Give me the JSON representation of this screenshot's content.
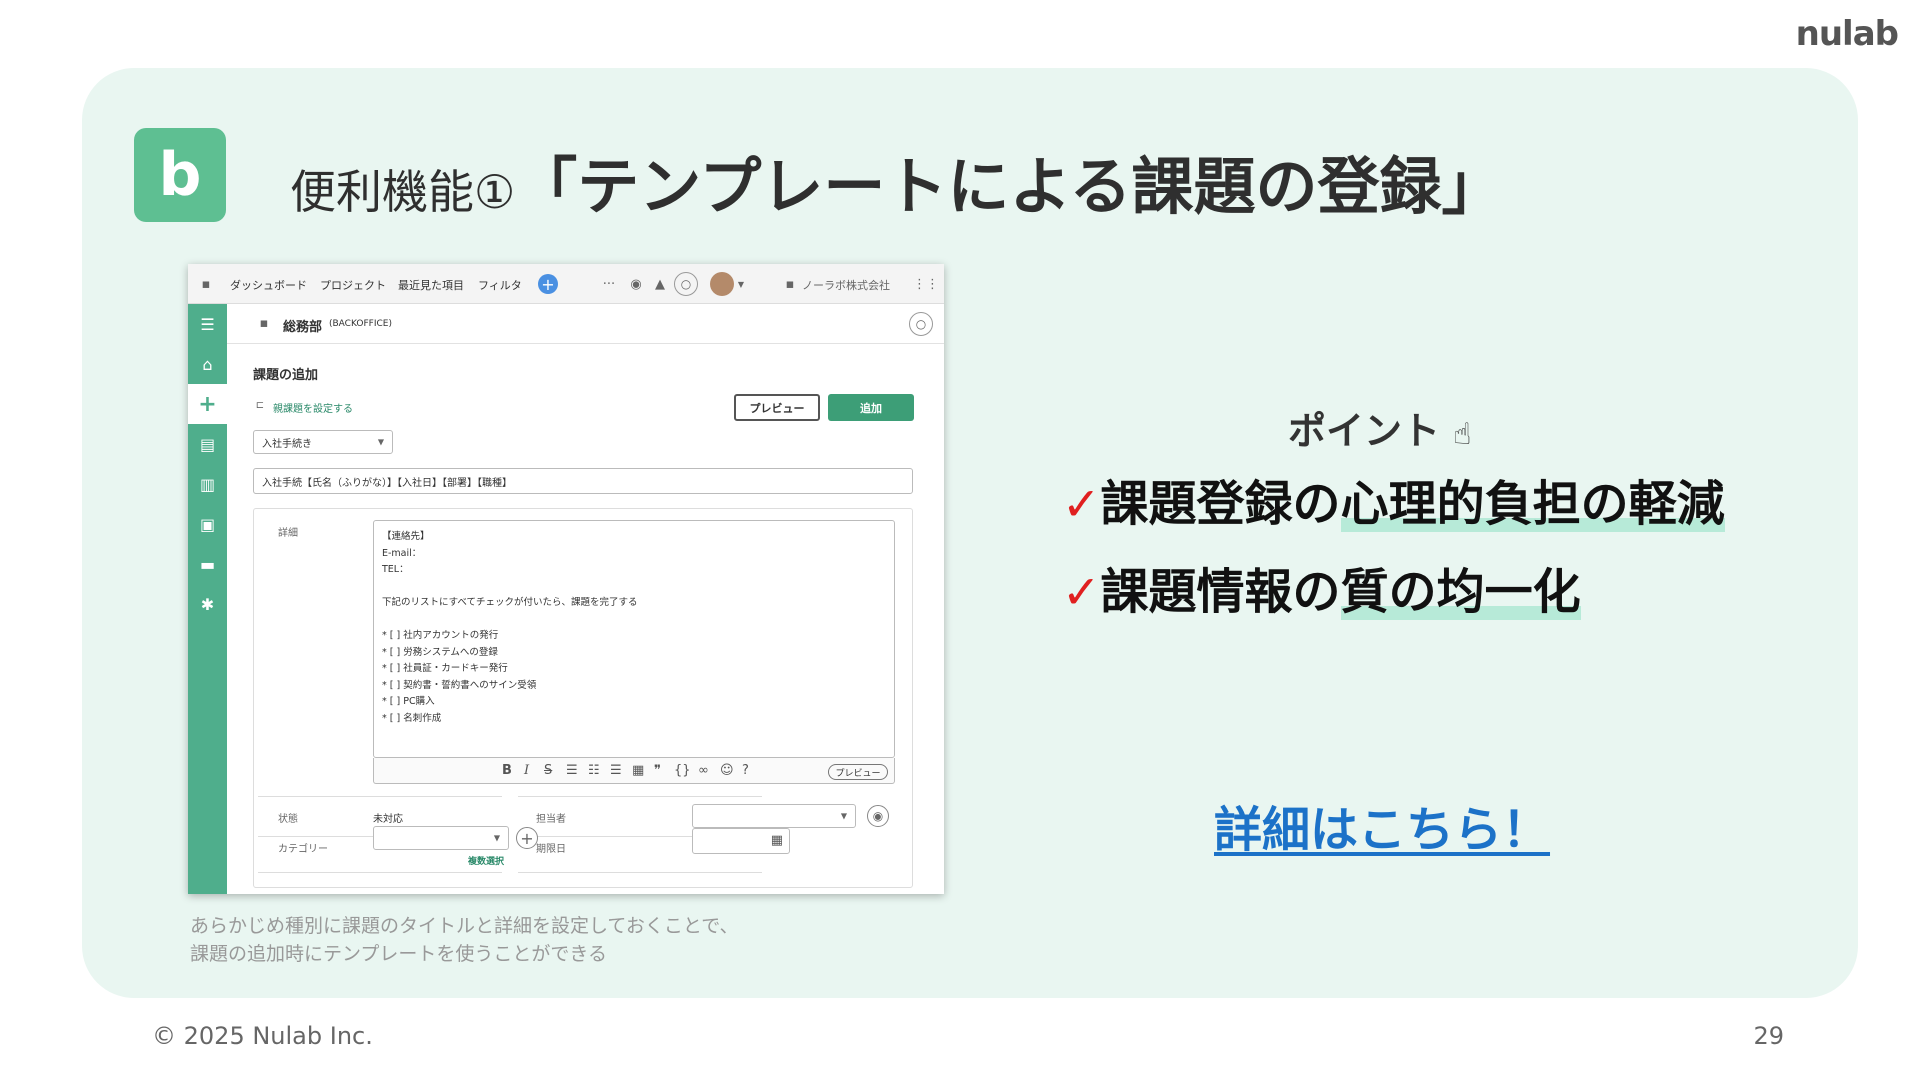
{
  "brand_logo": "nulab",
  "app_icon": "b",
  "title": {
    "prefix": "便利機能①",
    "main": "「テンプレートによる課題の登録」"
  },
  "screenshot": {
    "nav": {
      "items": [
        "ダッシュボード",
        "プロジェクト",
        "最近見た項目",
        "フィルタ"
      ],
      "org_name": "ノーラボ株式会社"
    },
    "project": {
      "name": "総務部",
      "key": "(BACKOFFICE)"
    },
    "form": {
      "title": "課題の追加",
      "parent_link": "親課題を設定する",
      "preview_label": "プレビュー",
      "add_label": "追加",
      "issue_type": "入社手続き",
      "subject": "入社手続【氏名（ふりがな）】【入社日】【部署】【職種】",
      "detail_label": "詳細",
      "detail_text": "【連絡先】\nE-mail：\nTEL：\n\n下記のリストにすべてチェックが付いたら、課題を完了する\n\n* [ ] 社内アカウントの発行\n* [ ] 労務システムへの登録\n* [ ] 社員証・カードキー発行\n* [ ] 契約書・誓約書へのサイン受領\n* [ ] PC購入\n* [ ] 名刺作成",
      "toolbar_preview": "プレビュー",
      "status_label": "状態",
      "status_value": "未対応",
      "assignee_label": "担当者",
      "category_label": "カテゴリー",
      "multi_select": "複数選択",
      "due_label": "期限日"
    }
  },
  "caption": {
    "line1": "あらかじめ種別に課題のタイトルと詳細を設定しておくことで、",
    "line2": "課題の追加時にテンプレートを使うことができる"
  },
  "points": {
    "heading": "ポイント",
    "items": [
      {
        "check": "✓",
        "plain": "課題登録の",
        "highlight": "心理的負担の軽減"
      },
      {
        "check": "✓",
        "plain": "課題情報の",
        "highlight": "質の均一化"
      }
    ]
  },
  "detail_link": "詳細はこちら！",
  "footer": {
    "copyright": "© 2025 Nulab Inc.",
    "page": "29"
  },
  "colors": {
    "panel_bg": "#e9f6f1",
    "backlog_green": "#5ebf92",
    "check_red": "#e02020",
    "link_blue": "#1c72c8",
    "highlight": "#b7ead8"
  }
}
